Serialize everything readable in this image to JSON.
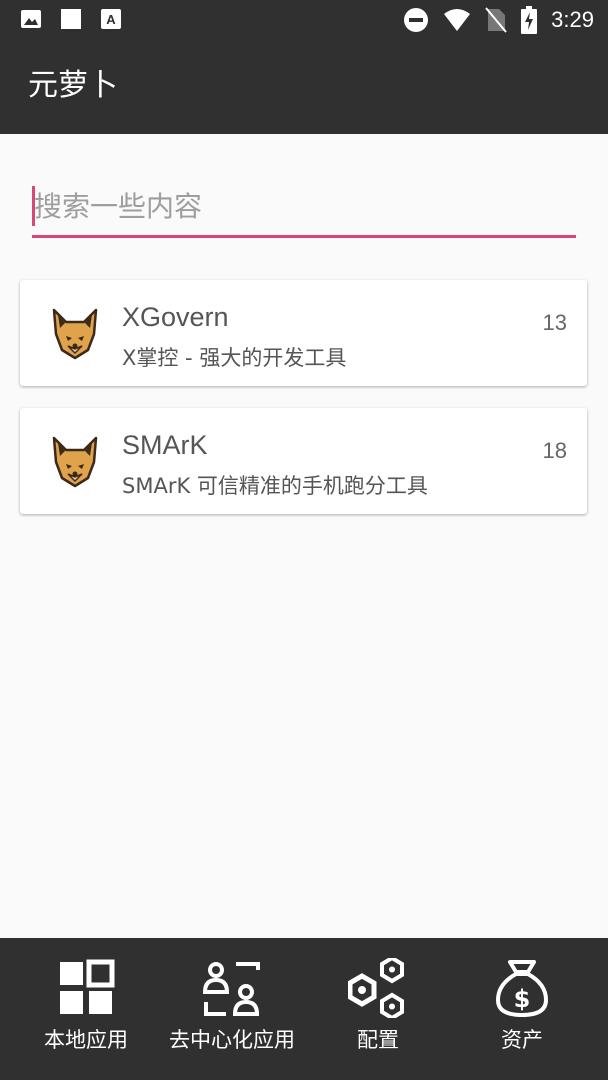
{
  "status_bar": {
    "time": "3:29",
    "icons": [
      "image-icon",
      "square-icon",
      "font-icon",
      "do-not-disturb-icon",
      "wifi-icon",
      "no-sim-icon",
      "battery-charging-icon"
    ]
  },
  "app_bar": {
    "title": "元萝卜"
  },
  "search": {
    "placeholder": "搜索一些内容",
    "value": "",
    "accent_color": "#d6477a"
  },
  "apps": [
    {
      "name": "XGovern",
      "description": "X掌控 - 强大的开发工具",
      "count": "13",
      "icon": "fox-icon"
    },
    {
      "name": "SMArK",
      "description": "SMArK 可信精准的手机跑分工具",
      "count": "18",
      "icon": "fox-icon"
    }
  ],
  "bottom_nav": {
    "items": [
      {
        "label": "本地应用",
        "icon": "grid-icon"
      },
      {
        "label": "去中心化应用",
        "icon": "people-icon"
      },
      {
        "label": "配置",
        "icon": "hexagon-nodes-icon"
      },
      {
        "label": "资产",
        "icon": "money-bag-icon"
      }
    ]
  }
}
